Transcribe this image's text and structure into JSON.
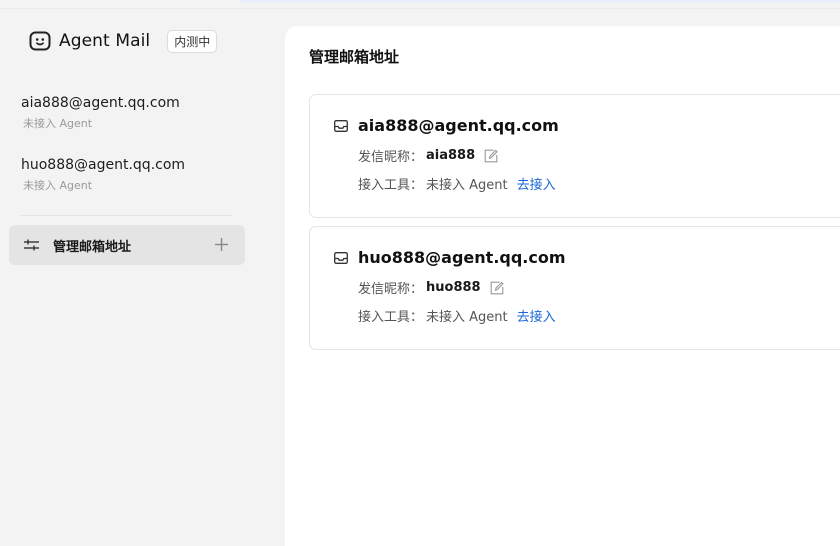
{
  "brand": {
    "name": "Agent Mail",
    "badge": "内测中",
    "icon": "smiley-face-icon"
  },
  "sidebar": {
    "mailboxes": [
      {
        "address": "aia888@agent.qq.com",
        "status": "未接入 Agent"
      },
      {
        "address": "huo888@agent.qq.com",
        "status": "未接入 Agent"
      }
    ],
    "manage": {
      "label": "管理邮箱地址",
      "icon": "sliders-icon",
      "add_icon": "plus-icon"
    }
  },
  "main": {
    "title": "管理邮箱地址",
    "cards": [
      {
        "address": "aia888@agent.qq.com",
        "nickname_label": "发信昵称：",
        "nickname": "aia888",
        "tool_label": "接入工具：",
        "tool_value": "未接入 Agent",
        "connect_link": "去接入"
      },
      {
        "address": "huo888@agent.qq.com",
        "nickname_label": "发信昵称：",
        "nickname": "huo888",
        "tool_label": "接入工具：",
        "tool_value": "未接入 Agent",
        "connect_link": "去接入"
      }
    ]
  },
  "colors": {
    "sidebar_bg": "#f3f3f3",
    "active_item_bg": "#e4e4e4",
    "link": "#1a66d6",
    "muted_text": "#9a9a9a"
  }
}
